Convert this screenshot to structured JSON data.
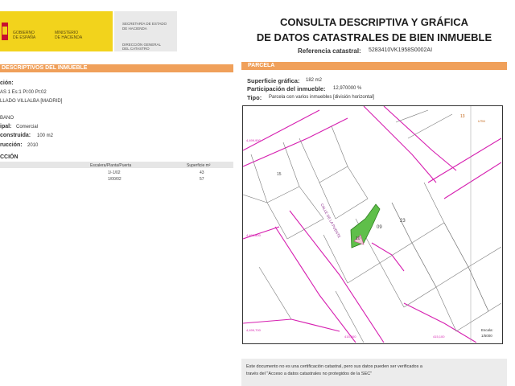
{
  "header": {
    "gov_line1": "GOBIERNO",
    "gov_line2": "DE ESPAÑA",
    "ministry_line1": "MINISTERIO",
    "ministry_line2": "DE HACIENDA",
    "secretaria_line1": "SECRETARÍA DE ESTADO",
    "secretaria_line2": "DE HACIENDA",
    "direccion_line1": "DIRECCIÓN GENERAL",
    "direccion_line2": "DEL CATASTRO",
    "title_line1": "CONSULTA DESCRIPTIVA Y GRÁFICA",
    "title_line2": "DE DATOS CATASTRALES DE BIEN INMUEBLE",
    "ref_label": "Referencia catastral:",
    "ref_value": "5283410VK1958S0002AI"
  },
  "left": {
    "section_title": "DESCRIPTIVOS DEL INMUEBLE",
    "loc_label": "ción:",
    "loc_line1": "AS 1 Es:1 Pl:00 Pt:02",
    "loc_line2": "LLADO VILLALBA [MADRID]",
    "clase": "BANO",
    "uso_label": "ipal:",
    "uso_value": "Comercial",
    "sup_label": "construida:",
    "sup_value": "100 m2",
    "anio_label": "rucción:",
    "anio_value": "2010",
    "constr_title": "CCIÓN",
    "table": {
      "headers": [
        "Escalera/Planta/Puerta",
        "Superficie m²"
      ],
      "rows": [
        [
          "1/-1/02",
          "43"
        ],
        [
          "1/00/02",
          "57"
        ]
      ]
    }
  },
  "right": {
    "section_title": "PARCELA",
    "sup_label": "Superficie gráfica:",
    "sup_value": "182 m2",
    "part_label": "Participación del inmueble:",
    "part_value": "12,970000 %",
    "tipo_label": "Tipo:",
    "tipo_value": "Parcela con varios inmuebles [división horizontal]",
    "map": {
      "labels": [
        "CALLE DE LA PUENTE",
        "23",
        "09",
        "10",
        "15",
        "13",
        "UTM",
        "415,000",
        "4,499,900",
        "4,499,800",
        "4,499,700",
        "415,100"
      ],
      "escala_label": "Escala:",
      "escala_value": "1/5000"
    },
    "note_line1": "Este documento no es una certificación catastral, pero sus datos pueden ser verificados a",
    "note_line2": "través del \"Acceso a datos catastrales no protegidos de la SEC\""
  },
  "colors": {
    "orange_bar": "#f0a05a",
    "gov_yellow": "#f2d31c",
    "map_lines": "#d61fb0",
    "parcel_green": "#5fbf4a"
  }
}
